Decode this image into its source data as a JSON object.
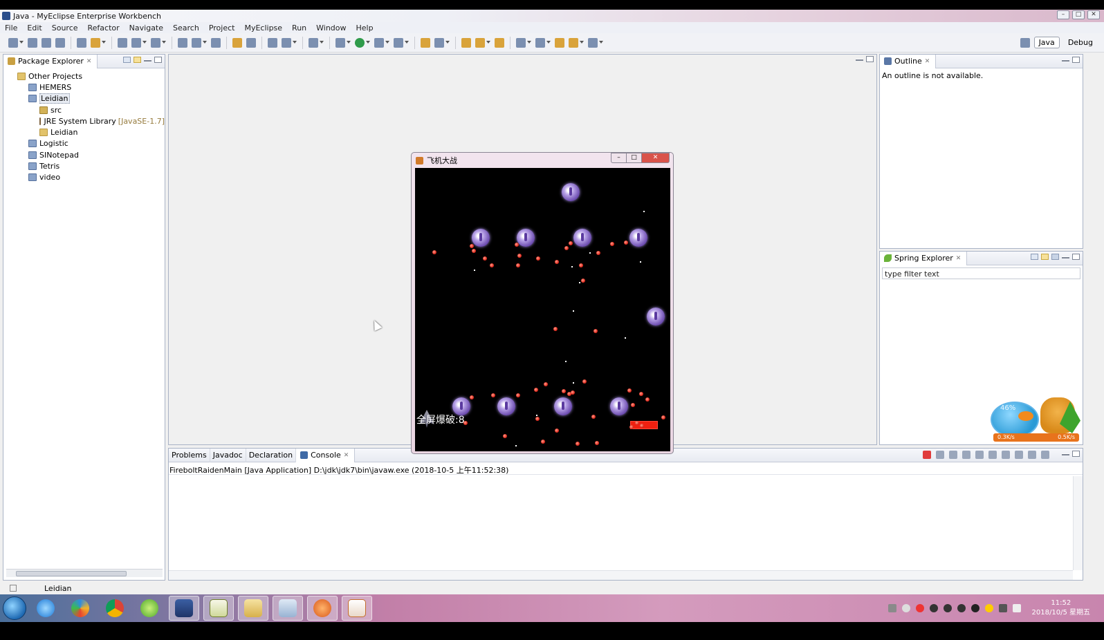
{
  "window": {
    "title": "Java - MyEclipse Enterprise Workbench"
  },
  "menu": [
    "File",
    "Edit",
    "Source",
    "Refactor",
    "Navigate",
    "Search",
    "Project",
    "MyEclipse",
    "Run",
    "Window",
    "Help"
  ],
  "perspectives": {
    "java": "Java",
    "debug": "Debug"
  },
  "package_explorer": {
    "tab": "Package Explorer",
    "items": [
      {
        "label": "Other Projects",
        "level": 0,
        "icon": "folder-icon"
      },
      {
        "label": "HEMERS",
        "level": 1,
        "icon": "project-icon"
      },
      {
        "label": "Leidian",
        "level": 1,
        "icon": "project-icon",
        "selected": true
      },
      {
        "label": "src",
        "level": 2,
        "icon": "source-folder-icon"
      },
      {
        "label": "JRE System Library",
        "suffix": "[JavaSE-1.7]",
        "level": 2,
        "icon": "library-icon"
      },
      {
        "label": "Leidian",
        "level": 2,
        "icon": "folder-icon"
      },
      {
        "label": "Logistic",
        "level": 1,
        "icon": "project-icon"
      },
      {
        "label": "SINotepad",
        "level": 1,
        "icon": "project-icon"
      },
      {
        "label": "Tetris",
        "level": 1,
        "icon": "project-icon"
      },
      {
        "label": "video",
        "level": 1,
        "icon": "project-icon"
      }
    ]
  },
  "outline": {
    "tab": "Outline",
    "message": "An outline is not available."
  },
  "spring_explorer": {
    "tab": "Spring Explorer",
    "filter_value": "type filter text"
  },
  "bottom_tabs": {
    "problems": "Problems",
    "javadoc": "Javadoc",
    "declaration": "Declaration",
    "console": "Console"
  },
  "console": {
    "description": "FireboltRaidenMain [Java Application] D:\\jdk\\jdk7\\bin\\javaw.exe (2018-10-5 上午11:52:38)"
  },
  "statusbar": {
    "selection": "Leidian"
  },
  "game": {
    "title": "飞机大战",
    "bomb_label": "全屏爆破:8"
  },
  "fish_widget": {
    "percent": "46%",
    "up_speed": "0.3K/s",
    "down_speed": "0.5K/s"
  },
  "taskbar": {
    "time": "11:52",
    "date": "2018/10/5 星期五"
  },
  "colors": {
    "bullet": "#e02b1f",
    "enemy": "#6d4db0",
    "hp_bar": "#f02010",
    "accent": "#2a4e8c"
  }
}
